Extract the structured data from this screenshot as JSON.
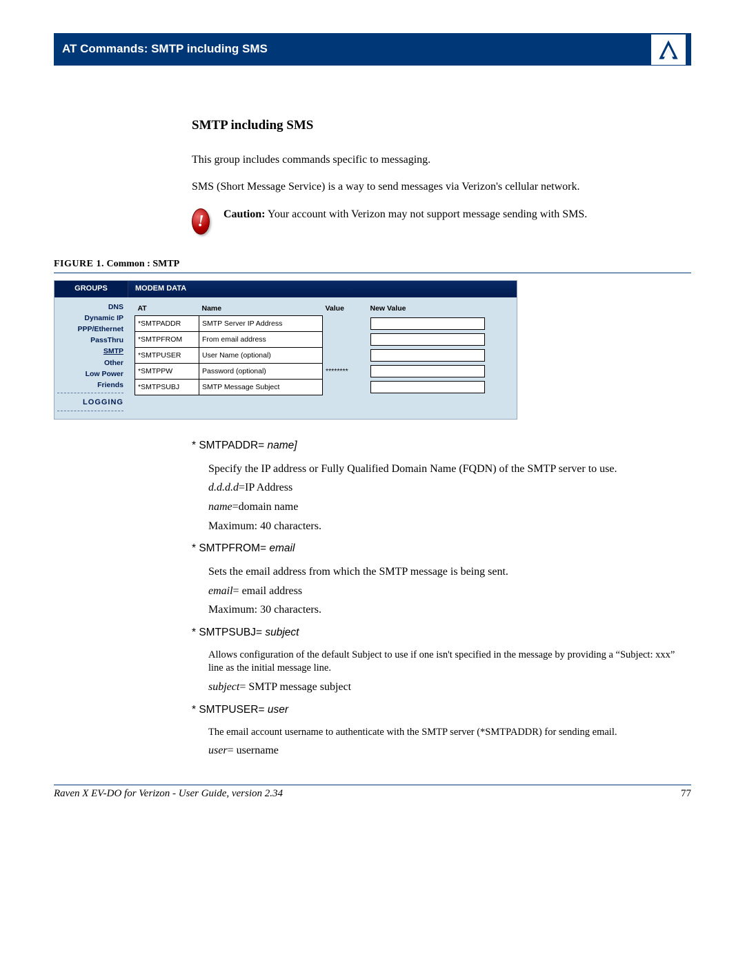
{
  "header": {
    "title": "AT Commands: SMTP including SMS"
  },
  "section": {
    "title": "SMTP including SMS"
  },
  "intro_p1": "This group includes commands specific to messaging.",
  "intro_p2": "SMS (Short Message Service) is a way to send messages via Verizon's cellular network.",
  "caution": {
    "label": "Caution:",
    "text": " Your account with Verizon may not support message sending with SMS."
  },
  "figure": {
    "label": "FIGURE 1.",
    "caption": " Common : SMTP"
  },
  "ui": {
    "groups_label": "GROUPS",
    "mdata_label": "MODEM DATA",
    "sidebar": {
      "dns": "DNS",
      "dynip": "Dynamic IP",
      "ppp": "PPP/Ethernet",
      "passthru": "PassThru",
      "smtp": "SMTP",
      "other": "Other",
      "lowpower": "Low Power",
      "friends": "Friends",
      "logging": "LOGGING"
    },
    "columns": {
      "at": "AT",
      "name": "Name",
      "value": "Value",
      "newvalue": "New Value"
    },
    "rows": [
      {
        "at": "*SMTPADDR",
        "name": "SMTP Server IP Address",
        "value": ""
      },
      {
        "at": "*SMTPFROM",
        "name": "From email address",
        "value": ""
      },
      {
        "at": "*SMTPUSER",
        "name": "User Name (optional)",
        "value": ""
      },
      {
        "at": "*SMTPPW",
        "name": "Password (optional)",
        "value": "********"
      },
      {
        "at": "*SMTPSUBJ",
        "name": "SMTP Message Subject",
        "value": ""
      }
    ]
  },
  "commands": {
    "smtpaddr": {
      "head_prefix": "* SMTPADDR= ",
      "head_arg": "name]",
      "desc": "Specify the IP address or Fully Qualified Domain Name (FQDN) of the SMTP server to use.",
      "l1_i": "d.d.d.d",
      "l1_t": "=IP Address",
      "l2_i": "name",
      "l2_t": "=domain name",
      "l3": "Maximum: 40 characters."
    },
    "smtpfrom": {
      "head_prefix": "* SMTPFROM= ",
      "head_arg": "email",
      "desc": "Sets the email address from which the SMTP message is being sent.",
      "l1_i": "email",
      "l1_t": "= email address",
      "l2": "Maximum: 30 characters."
    },
    "smtpsubj": {
      "head_prefix": "* SMTPSUBJ= ",
      "head_arg": "subject",
      "desc": "Allows configuration of the default Subject to use if one isn't specified in the message by providing a “Subject: xxx” line as the initial message line.",
      "l1_i": "subject",
      "l1_t": "= SMTP message subject"
    },
    "smtpuser": {
      "head_prefix": "* SMTPUSER= ",
      "head_arg": "user",
      "desc": "The email account username to authenticate with the SMTP server (*SMTPADDR) for sending email.",
      "l1_i": "user",
      "l1_t": "= username"
    }
  },
  "footer": {
    "text": "Raven X EV-DO for Verizon - User Guide, version 2.34",
    "page": "77"
  }
}
